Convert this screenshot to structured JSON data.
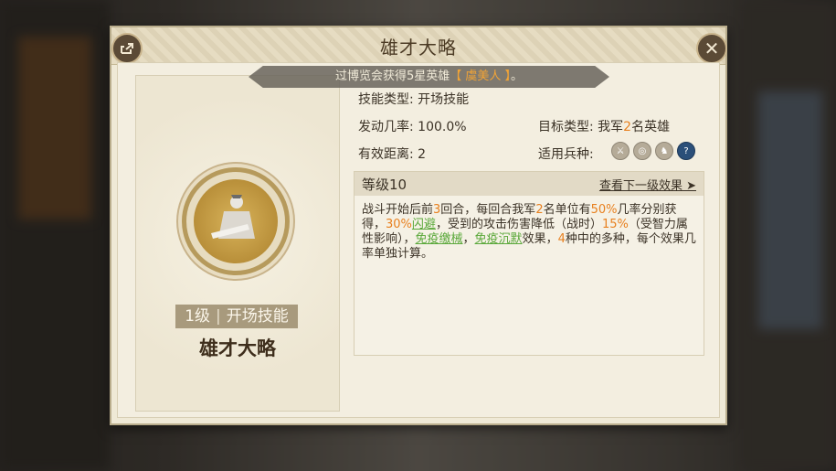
{
  "header": {
    "title": "雄才大略"
  },
  "notice": {
    "prefix": "过博览会获得5星英雄",
    "hero": "【 虞美人 】",
    "suffix": "。"
  },
  "skill": {
    "level_label": "1级",
    "type_tag": "开场技能",
    "name": "雄才大略"
  },
  "info": {
    "type_label": "技能类型:",
    "type_value": "开场技能",
    "rate_label": "发动几率:",
    "rate_value": "100.0%",
    "target_label": "目标类型:",
    "target_value_pre": "我军",
    "target_num": "2",
    "target_value_post": "名英雄",
    "range_label": "有效距离:",
    "range_value": "2",
    "units_label": "适用兵种:",
    "unit_icons": [
      "sword-icon",
      "target-icon",
      "horse-icon",
      "question-icon"
    ]
  },
  "effect": {
    "level": "等级10",
    "next_link": "查看下一级效果 ➤",
    "t1": "战斗开始后前",
    "n1": "3",
    "t2": "回合，每回合我军",
    "n2": "2",
    "t3": "名单位有",
    "n3": "50%",
    "t4": "几率分别获得，",
    "n4": "30%",
    "g1": "闪避",
    "t5": "，受到的攻击伤害降低（战时）",
    "n5": "15%",
    "t6": "（受智力属性影响），",
    "g2": "免疫缴械",
    "t7": "，",
    "g3": "免疫沉默",
    "t8": "效果，",
    "n6": "4",
    "t9": "种中的多种，每个效果几率单独计算。"
  },
  "colors": {
    "accent_orange": "#e8801f",
    "accent_green": "#5aa83a",
    "panel_bg": "#efe9d6"
  }
}
